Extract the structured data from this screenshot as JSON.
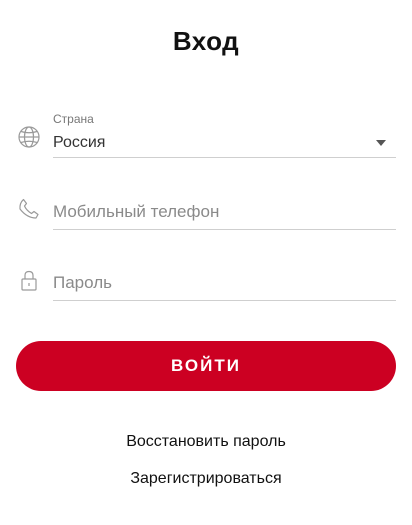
{
  "header": {
    "title": "Вход"
  },
  "form": {
    "country": {
      "label": "Страна",
      "value": "Россия",
      "icon": "globe-icon"
    },
    "phone": {
      "placeholder": "Мобильный телефон",
      "icon": "phone-icon"
    },
    "password": {
      "placeholder": "Пароль",
      "icon": "lock-icon"
    },
    "submit_label": "ВОЙТИ"
  },
  "links": {
    "restore_password": "Восстановить пароль",
    "register": "Зарегистрироваться"
  },
  "colors": {
    "accent": "#cc0022",
    "divider": "#cfcfcf",
    "icon": "#9a9a9a"
  }
}
